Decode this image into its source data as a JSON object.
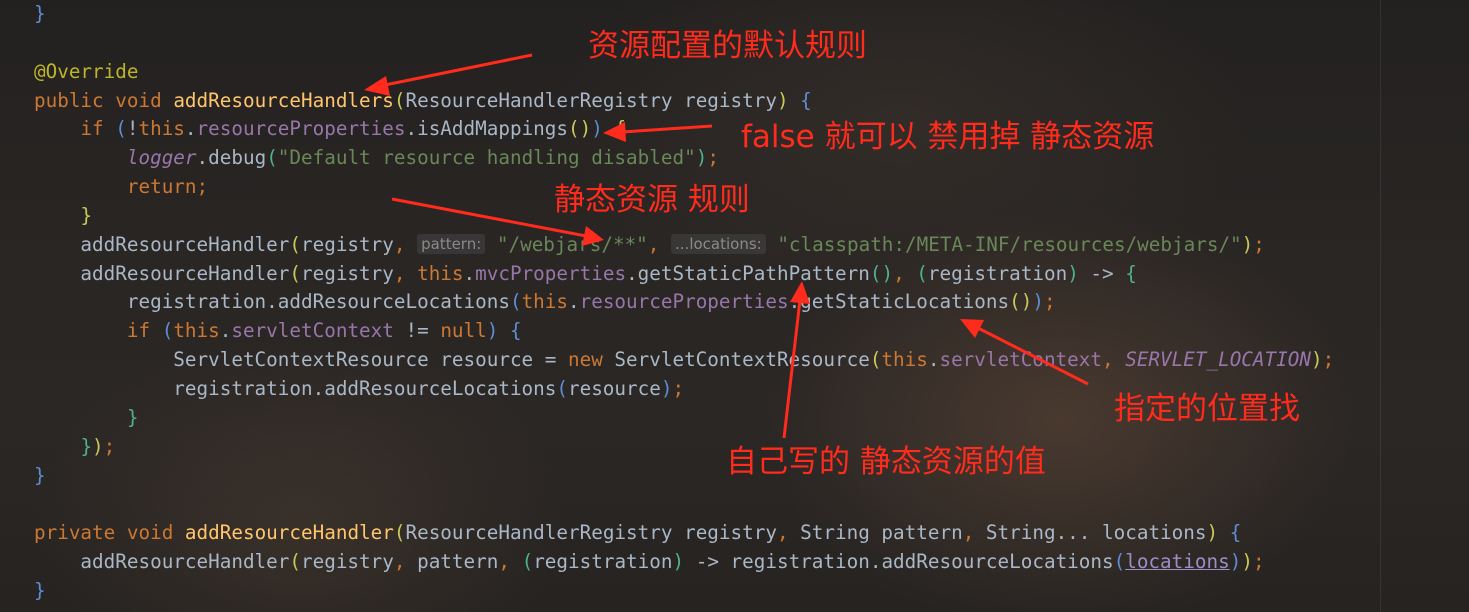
{
  "editor": {
    "lines": [
      {
        "segs": [
          {
            "c": "p1",
            "t": "}"
          }
        ]
      },
      {
        "segs": []
      },
      {
        "segs": [
          {
            "c": "ann",
            "t": "@Override"
          }
        ]
      },
      {
        "segs": [
          {
            "c": "kw",
            "t": "public void "
          },
          {
            "c": "fn",
            "t": "addResourceHandlers"
          },
          {
            "c": "p2",
            "t": "("
          },
          {
            "c": "",
            "t": "ResourceHandlerRegistry registry"
          },
          {
            "c": "p2",
            "t": ")"
          },
          {
            "c": "",
            "t": " "
          },
          {
            "c": "p1",
            "t": "{"
          }
        ]
      },
      {
        "segs": [
          {
            "c": "",
            "t": "    "
          },
          {
            "c": "kw",
            "t": "if "
          },
          {
            "c": "p1",
            "t": "("
          },
          {
            "c": "",
            "t": "!"
          },
          {
            "c": "kw",
            "t": "this"
          },
          {
            "c": "",
            "t": "."
          },
          {
            "c": "fld",
            "t": "resourceProperties"
          },
          {
            "c": "",
            "t": ".isAddMappings"
          },
          {
            "c": "p2",
            "t": "()"
          },
          {
            "c": "p1",
            "t": ")"
          },
          {
            "c": "",
            "t": " "
          },
          {
            "c": "p2",
            "t": "{"
          }
        ]
      },
      {
        "segs": [
          {
            "c": "",
            "t": "        "
          },
          {
            "c": "fld it",
            "t": "logger"
          },
          {
            "c": "",
            "t": ".debug"
          },
          {
            "c": "p3",
            "t": "("
          },
          {
            "c": "str",
            "t": "\"Default resource handling disabled\""
          },
          {
            "c": "p3",
            "t": ")"
          },
          {
            "c": "kw",
            "t": ";"
          }
        ]
      },
      {
        "segs": [
          {
            "c": "",
            "t": "        "
          },
          {
            "c": "kw",
            "t": "return;"
          }
        ]
      },
      {
        "segs": [
          {
            "c": "",
            "t": "    "
          },
          {
            "c": "p2",
            "t": "}"
          }
        ]
      },
      {
        "segs": [
          {
            "c": "",
            "t": "    addResourceHandler"
          },
          {
            "c": "p2",
            "t": "("
          },
          {
            "c": "",
            "t": "registry"
          },
          {
            "c": "kw",
            "t": ", "
          },
          {
            "c": "hint",
            "t": "pattern:"
          },
          {
            "c": "",
            "t": " "
          },
          {
            "c": "str",
            "t": "\"/webjars/**\""
          },
          {
            "c": "kw",
            "t": ", "
          },
          {
            "c": "hint",
            "t": "...locations:"
          },
          {
            "c": "",
            "t": " "
          },
          {
            "c": "str",
            "t": "\"classpath:/META-INF/resources/webjars/\""
          },
          {
            "c": "p2",
            "t": ")"
          },
          {
            "c": "kw",
            "t": ";"
          }
        ]
      },
      {
        "segs": [
          {
            "c": "",
            "t": "    addResourceHandler"
          },
          {
            "c": "p2",
            "t": "("
          },
          {
            "c": "",
            "t": "registry"
          },
          {
            "c": "kw",
            "t": ", this"
          },
          {
            "c": "",
            "t": "."
          },
          {
            "c": "fld",
            "t": "mvcProperties"
          },
          {
            "c": "",
            "t": ".getStaticPathPattern"
          },
          {
            "c": "p3",
            "t": "()"
          },
          {
            "c": "kw",
            "t": ", "
          },
          {
            "c": "p3",
            "t": "("
          },
          {
            "c": "",
            "t": "registration"
          },
          {
            "c": "p3",
            "t": ")"
          },
          {
            "c": "",
            "t": " -> "
          },
          {
            "c": "p3",
            "t": "{"
          }
        ]
      },
      {
        "segs": [
          {
            "c": "",
            "t": "        registration.addResourceLocations"
          },
          {
            "c": "p1",
            "t": "("
          },
          {
            "c": "kw",
            "t": "this"
          },
          {
            "c": "",
            "t": "."
          },
          {
            "c": "fld",
            "t": "resourceProperties"
          },
          {
            "c": "",
            "t": ".getStaticLocations"
          },
          {
            "c": "p2",
            "t": "()"
          },
          {
            "c": "p1",
            "t": ")"
          },
          {
            "c": "kw",
            "t": ";"
          }
        ]
      },
      {
        "segs": [
          {
            "c": "",
            "t": "        "
          },
          {
            "c": "kw",
            "t": "if "
          },
          {
            "c": "p1",
            "t": "("
          },
          {
            "c": "kw",
            "t": "this"
          },
          {
            "c": "",
            "t": "."
          },
          {
            "c": "fld",
            "t": "servletContext"
          },
          {
            "c": "",
            "t": " != "
          },
          {
            "c": "kw",
            "t": "null"
          },
          {
            "c": "p1",
            "t": ")"
          },
          {
            "c": "",
            "t": " "
          },
          {
            "c": "p1",
            "t": "{"
          }
        ]
      },
      {
        "segs": [
          {
            "c": "",
            "t": "            ServletContextResource resource = "
          },
          {
            "c": "kw",
            "t": "new "
          },
          {
            "c": "",
            "t": "ServletContextResource"
          },
          {
            "c": "p2",
            "t": "("
          },
          {
            "c": "kw",
            "t": "this"
          },
          {
            "c": "",
            "t": "."
          },
          {
            "c": "fld",
            "t": "servletContext"
          },
          {
            "c": "kw",
            "t": ", "
          },
          {
            "c": "fld it",
            "t": "SERVLET_LOCATION"
          },
          {
            "c": "p2",
            "t": ")"
          },
          {
            "c": "kw",
            "t": ";"
          }
        ]
      },
      {
        "segs": [
          {
            "c": "",
            "t": "            registration.addResourceLocations"
          },
          {
            "c": "p1",
            "t": "("
          },
          {
            "c": "",
            "t": "resource"
          },
          {
            "c": "p1",
            "t": ")"
          },
          {
            "c": "kw",
            "t": ";"
          }
        ]
      },
      {
        "segs": [
          {
            "c": "",
            "t": "        "
          },
          {
            "c": "p3",
            "t": "}"
          }
        ]
      },
      {
        "segs": [
          {
            "c": "",
            "t": "    "
          },
          {
            "c": "p3",
            "t": "}"
          },
          {
            "c": "p2",
            "t": ")"
          },
          {
            "c": "kw",
            "t": ";"
          }
        ]
      },
      {
        "segs": [
          {
            "c": "p1",
            "t": "}"
          }
        ]
      },
      {
        "segs": []
      },
      {
        "segs": [
          {
            "c": "kw",
            "t": "private void "
          },
          {
            "c": "fn",
            "t": "addResourceHandler"
          },
          {
            "c": "p2",
            "t": "("
          },
          {
            "c": "",
            "t": "ResourceHandlerRegistry registry"
          },
          {
            "c": "kw",
            "t": ", "
          },
          {
            "c": "",
            "t": "String pattern"
          },
          {
            "c": "kw",
            "t": ", "
          },
          {
            "c": "",
            "t": "String... locations"
          },
          {
            "c": "p2",
            "t": ")"
          },
          {
            "c": "",
            "t": " "
          },
          {
            "c": "p1",
            "t": "{"
          }
        ]
      },
      {
        "segs": [
          {
            "c": "",
            "t": "    addResourceHandler"
          },
          {
            "c": "p2",
            "t": "("
          },
          {
            "c": "",
            "t": "registry"
          },
          {
            "c": "kw",
            "t": ", "
          },
          {
            "c": "",
            "t": "pattern"
          },
          {
            "c": "kw",
            "t": ", "
          },
          {
            "c": "p3",
            "t": "("
          },
          {
            "c": "",
            "t": "registration"
          },
          {
            "c": "p3",
            "t": ")"
          },
          {
            "c": "",
            "t": " -> registration.addResourceLocations"
          },
          {
            "c": "p1",
            "t": "("
          },
          {
            "c": "sig u",
            "t": "locations"
          },
          {
            "c": "p1",
            "t": ")"
          },
          {
            "c": "p2",
            "t": ")"
          },
          {
            "c": "kw",
            "t": ";"
          }
        ]
      },
      {
        "segs": [
          {
            "c": "p1",
            "t": "}"
          }
        ]
      }
    ]
  },
  "annotations": {
    "default_rules": "资源配置的默认规则",
    "disable_static": "false 就可以 禁用掉 静态资源",
    "static_rules": "静态资源 规则",
    "custom_static_value": "自己写的 静态资源的值",
    "specified_location": "指定的位置找"
  },
  "colors": {
    "annotation_red": "#ff2b1c",
    "keyword": "#cc7832",
    "method": "#ffc66d",
    "field": "#9876aa",
    "string": "#6a8759",
    "default_text": "#a9b7c6"
  }
}
